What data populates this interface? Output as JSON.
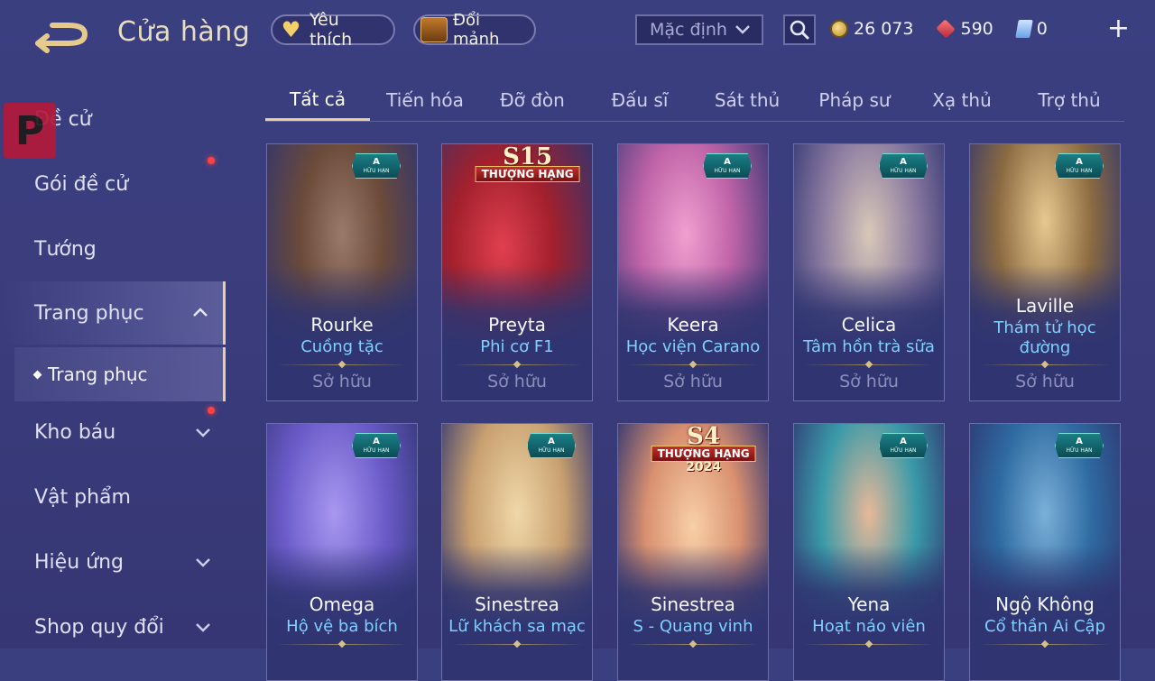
{
  "header": {
    "title": "Cửa hàng",
    "favorites_label": "Yêu thích",
    "shards_label": "Đổi mảnh",
    "sort_value": "Mặc định",
    "gold": "26 073",
    "gems": "590",
    "vouchers": "0"
  },
  "sidebar": {
    "items": [
      {
        "label": "Đề cử"
      },
      {
        "label": "Gói đề cử"
      },
      {
        "label": "Tướng"
      },
      {
        "label": "Trang phục"
      },
      {
        "label": "Trang phục"
      },
      {
        "label": "Kho báu"
      },
      {
        "label": "Vật phẩm"
      },
      {
        "label": "Hiệu ứng"
      },
      {
        "label": "Shop quy đổi"
      }
    ]
  },
  "tabs": [
    {
      "label": "Tất cả"
    },
    {
      "label": "Tiến hóa"
    },
    {
      "label": "Đỡ đòn"
    },
    {
      "label": "Đấu sĩ"
    },
    {
      "label": "Sát thủ"
    },
    {
      "label": "Pháp sư"
    },
    {
      "label": "Xạ thủ"
    },
    {
      "label": "Trợ thủ"
    }
  ],
  "cards": [
    {
      "hero": "Rourke",
      "skin": "Cuồng tặc",
      "status": "Sở hữu",
      "badge_grade": "A",
      "badge_text": "HỮU HẠN",
      "art_color": "#6b4a3a"
    },
    {
      "hero": "Preyta",
      "skin": "Phi cơ F1",
      "status": "Sở hữu",
      "season": "S15",
      "season_rank": "THƯỢNG HẠNG",
      "art_color": "#a3202c"
    },
    {
      "hero": "Keera",
      "skin": "Học viện Carano",
      "status": "Sở hữu",
      "badge_grade": "A",
      "badge_text": "HỮU HẠN",
      "art_color": "#c064a8"
    },
    {
      "hero": "Celica",
      "skin": "Tâm hồn trà sữa",
      "status": "Sở hữu",
      "badge_grade": "A",
      "badge_text": "HỮU HẠN",
      "art_color": "#8a7aa0"
    },
    {
      "hero": "Laville",
      "skin": "Thám tử học đường",
      "status": "Sở hữu",
      "badge_grade": "A",
      "badge_text": "HỮU HẠN",
      "art_color": "#8a6a40"
    },
    {
      "hero": "Omega",
      "skin": "Hộ vệ ba bích",
      "status": "",
      "badge_grade": "A",
      "badge_text": "HỮU HẠN",
      "art_color": "#6a5ac8"
    },
    {
      "hero": "Sinestrea",
      "skin": "Lữ khách sa mạc",
      "status": "",
      "badge_grade": "A",
      "badge_text": "HỮU HẠN",
      "art_color": "#c8a070"
    },
    {
      "hero": "Sinestrea",
      "skin": "S - Quang vinh",
      "status": "",
      "season": "S4",
      "season_rank": "THƯỢNG HẠNG",
      "season_year": "2024",
      "art_color": "#d89070"
    },
    {
      "hero": "Yena",
      "skin": "Hoạt náo viên",
      "status": "",
      "badge_grade": "A",
      "badge_text": "HỮU HẠN",
      "art_color": "#3a9aa8"
    },
    {
      "hero": "Ngộ Không",
      "skin": "Cổ thần Ai Cập",
      "status": "",
      "badge_grade": "A",
      "badge_text": "HỮU HẠN",
      "art_color": "#2e6aa0"
    }
  ]
}
